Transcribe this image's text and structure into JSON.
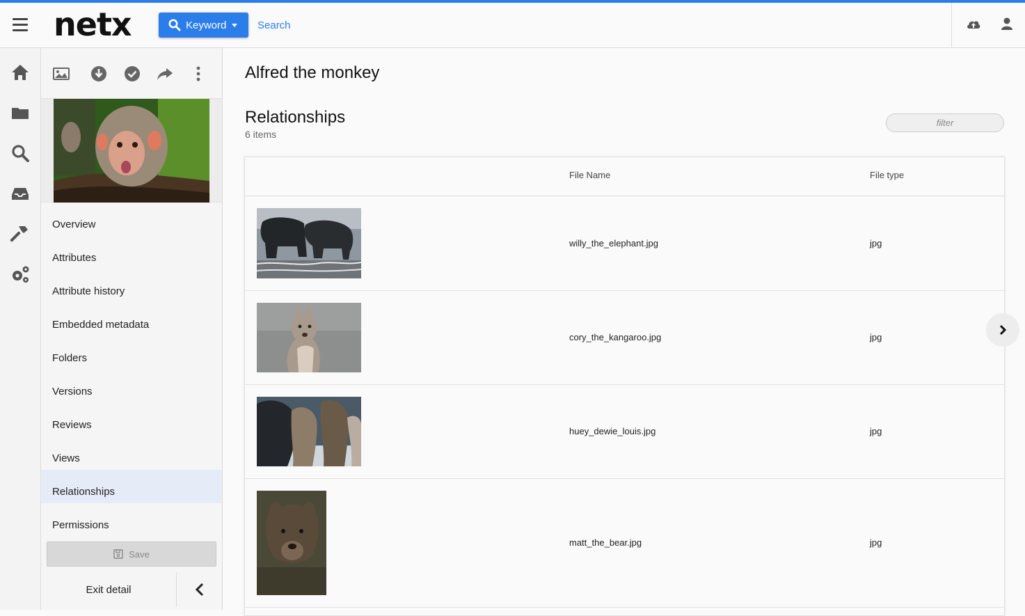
{
  "header": {
    "logo": "netx",
    "keyword_label": "Keyword",
    "search_placeholder": "Search",
    "accent": "#2b7de9"
  },
  "detail": {
    "menu": [
      {
        "label": "Overview"
      },
      {
        "label": "Attributes"
      },
      {
        "label": "Attribute history"
      },
      {
        "label": "Embedded metadata"
      },
      {
        "label": "Folders"
      },
      {
        "label": "Versions"
      },
      {
        "label": "Reviews"
      },
      {
        "label": "Views"
      },
      {
        "label": "Relationships",
        "active": true
      },
      {
        "label": "Permissions"
      }
    ],
    "save_label": "Save",
    "exit_label": "Exit detail"
  },
  "main": {
    "title": "Alfred the monkey",
    "section_title": "Relationships",
    "count": "6 items",
    "filter_placeholder": "filter",
    "columns": {
      "file_name": "File Name",
      "file_type": "File type"
    },
    "rows": [
      {
        "file_name": "willy_the_elephant.jpg",
        "file_type": "jpg"
      },
      {
        "file_name": "cory_the_kangaroo.jpg",
        "file_type": "jpg"
      },
      {
        "file_name": "huey_dewie_louis.jpg",
        "file_type": "jpg"
      },
      {
        "file_name": "matt_the_bear.jpg",
        "file_type": "jpg"
      }
    ]
  }
}
